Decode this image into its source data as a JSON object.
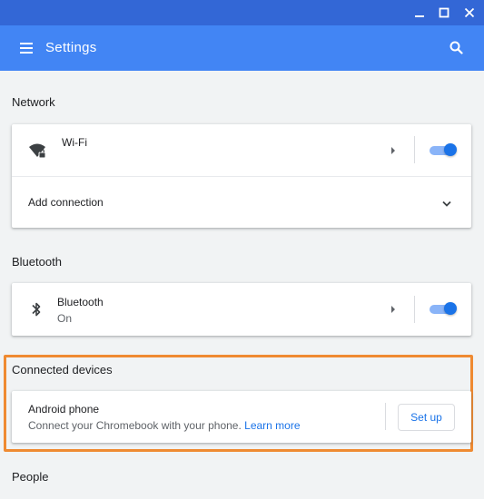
{
  "window": {
    "minimize_icon": "minimize-icon",
    "maximize_icon": "maximize-icon",
    "close_icon": "close-icon"
  },
  "appbar": {
    "title": "Settings",
    "menu_icon": "menu-icon",
    "search_icon": "search-icon",
    "color": "#4285f4"
  },
  "network": {
    "title": "Network",
    "wifi_label": "Wi-Fi",
    "wifi_icon": "wifi-locked-icon",
    "wifi_enabled": true,
    "add_connection_label": "Add connection"
  },
  "bluetooth": {
    "title": "Bluetooth",
    "label": "Bluetooth",
    "status": "On",
    "icon": "bluetooth-icon",
    "enabled": true
  },
  "connected_devices": {
    "title": "Connected devices",
    "device_label": "Android phone",
    "description": "Connect your Chromebook with your phone.",
    "learn_more": "Learn more",
    "setup_button": "Set up",
    "highlight_color": "#ef8a31"
  },
  "people": {
    "title": "People"
  }
}
